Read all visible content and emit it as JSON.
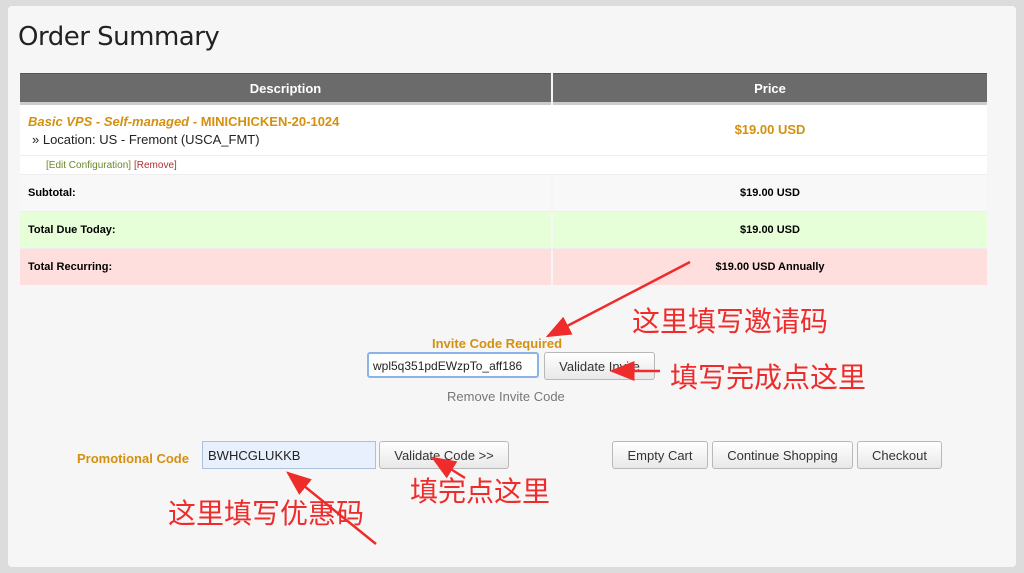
{
  "page_title": "Order Summary",
  "table": {
    "headers": {
      "description": "Description",
      "price": "Price"
    },
    "product": {
      "name": "Basic VPS - Self-managed",
      "separator": " - ",
      "code": "MINICHICKEN-20-1024",
      "location": "» Location: US - Fremont (USCA_FMT)",
      "price": "$19.00 USD",
      "edit_link": "[Edit Configuration]",
      "remove_link": "[Remove]"
    },
    "summary": [
      {
        "label": "Subtotal:",
        "value": "$19.00 USD"
      },
      {
        "label": "Total Due Today:",
        "value": "$19.00 USD"
      },
      {
        "label": "Total Recurring:",
        "value": "$19.00 USD Annually"
      }
    ]
  },
  "invite": {
    "label": "Invite Code Required",
    "value": "wpl5q351pdEWzpTo_aff186",
    "validate_button": "Validate Invite",
    "remove_link": "Remove Invite Code"
  },
  "promo": {
    "label": "Promotional Code",
    "value": "BWHCGLUKKB",
    "validate_button": "Validate Code >>"
  },
  "actions": {
    "empty_cart": "Empty Cart",
    "continue_shopping": "Continue Shopping",
    "checkout": "Checkout"
  },
  "annotations": {
    "invite_hint": "这里填写邀请码",
    "invite_click_hint": "填写完成点这里",
    "promo_hint": "这里填写优惠码",
    "promo_click_hint": "填完点这里",
    "color": "#ee2c2c"
  },
  "colors": {
    "accent": "#d4900e",
    "header_bg": "#6b6b6b",
    "due_today_bg": "#e6ffd9",
    "recurring_bg": "#ffdede"
  }
}
